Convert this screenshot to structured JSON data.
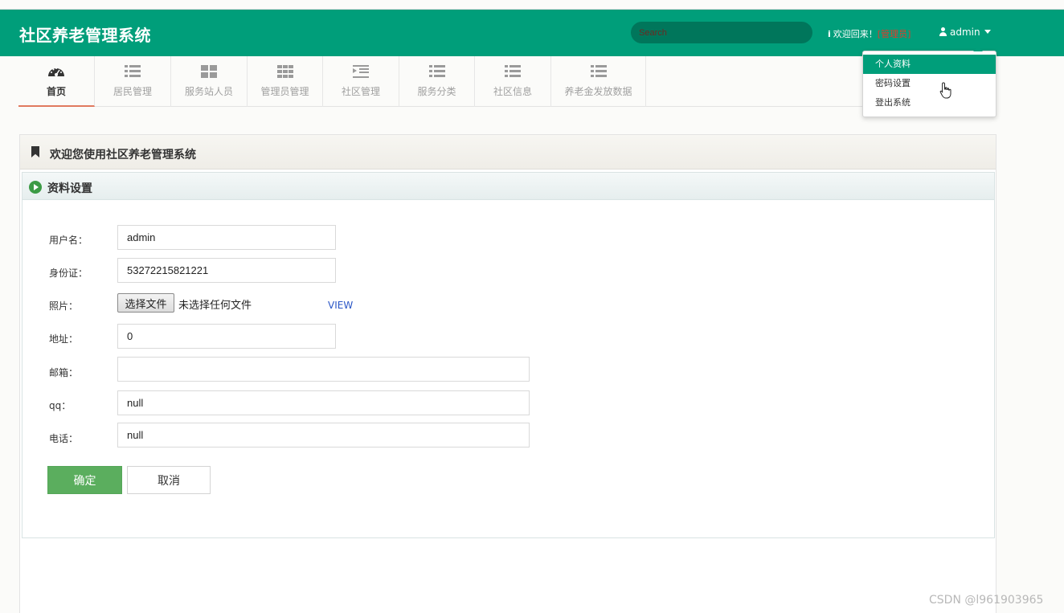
{
  "header": {
    "app_title": "社区养老管理系统",
    "search_placeholder": "Search",
    "welcome_text": "欢迎回来！",
    "role_text": "[管理员]",
    "user_name": "admin",
    "bg_color": "#009e7a"
  },
  "dropdown": {
    "items": [
      {
        "label": "个人资料",
        "active": true
      },
      {
        "label": "密码设置"
      },
      {
        "label": "登出系统"
      }
    ]
  },
  "nav": {
    "tabs": [
      {
        "label": "首页",
        "icon": "dashboard-icon",
        "active": true
      },
      {
        "label": "居民管理",
        "icon": "list-icon"
      },
      {
        "label": "服务站人员",
        "icon": "grid-icon"
      },
      {
        "label": "管理员管理",
        "icon": "grid-icon"
      },
      {
        "label": "社区管理",
        "icon": "indent-list-icon"
      },
      {
        "label": "服务分类",
        "icon": "list-icon"
      },
      {
        "label": "社区信息",
        "icon": "list-icon"
      },
      {
        "label": "养老金发放数据",
        "icon": "list-icon"
      }
    ]
  },
  "panel": {
    "title": "欢迎您使用社区养老管理系统",
    "sub_title": "资料设置"
  },
  "form": {
    "username_label": "用户名：",
    "username_value": "admin",
    "idcard_label": "身份证：",
    "idcard_value": "53272215821221",
    "photo_label": "照片：",
    "file_button": "选择文件",
    "file_status": "未选择任何文件",
    "view_link": "VIEW",
    "address_label": "地址：",
    "address_value": "0",
    "email_label": "邮箱：",
    "email_value": "",
    "qq_label": "qq：",
    "qq_value": "null",
    "phone_label": "电话：",
    "phone_value": "null",
    "ok_label": "确定",
    "cancel_label": "取消"
  },
  "watermark": "CSDN @l961903965"
}
